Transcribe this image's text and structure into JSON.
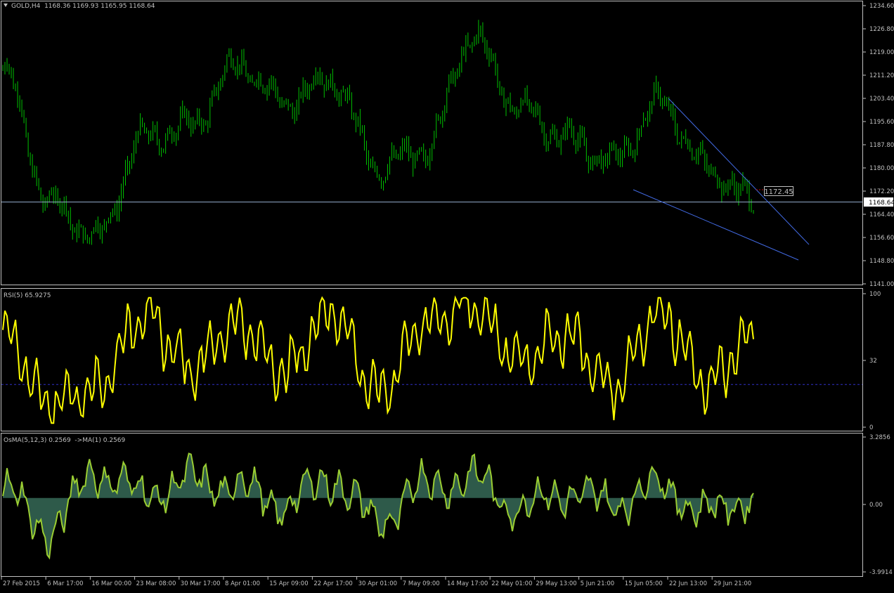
{
  "colors": {
    "background": "#000000",
    "frame": "#C0C0C0",
    "candles": "#00C000",
    "rsi_line": "#FFFF00",
    "osma_line": "#9ACD32",
    "osma_fill": "#2E5A4A",
    "trendline": "#4169E1",
    "bid_line": "#8FA8C8",
    "level_line": "#3030C8",
    "alert_line": "#C00000",
    "text": "#C0C0C0"
  },
  "price_panel": {
    "title": "GOLD,H4  1168.36 1169.93 1165.95 1168.64",
    "symbol_icon": "triangle-down-icon",
    "current_price_label": "1168.64",
    "marker_label": "1172.45",
    "marker_price": 1172.45,
    "y_axis_labels": [
      "1234.60",
      "1226.80",
      "1219.00",
      "1211.20",
      "1203.40",
      "1195.60",
      "1187.80",
      "1180.00",
      "1172.20",
      "1164.40",
      "1156.60",
      "1148.80",
      "1141.00"
    ]
  },
  "rsi_panel": {
    "title": "RSI(5) 65.9275",
    "y_axis_labels": [
      "100",
      "32",
      "0"
    ],
    "level": 32
  },
  "osma_panel": {
    "title": "OsMA(5,12,3) 0.2569  ->MA(1) 0.2569",
    "y_axis_labels": [
      "3.2856",
      "0.00",
      "-3.9914"
    ]
  },
  "time_axis": {
    "labels": [
      "27 Feb 2015",
      "6 Mar 17:00",
      "16 Mar 00:00",
      "23 Mar 08:00",
      "30 Mar 17:00",
      "8 Apr 01:00",
      "15 Apr 09:00",
      "22 Apr 17:00",
      "30 Apr 01:00",
      "7 May 09:00",
      "14 May 17:00",
      "22 May 01:00",
      "29 May 13:00",
      "5 Jun 21:00",
      "15 Jun 05:00",
      "22 Jun 13:00",
      "29 Jun 21:00"
    ]
  },
  "chart_data": [
    {
      "type": "line",
      "series": [
        {
          "name": "GOLD,H4",
          "x": [
            "27 Feb 2015",
            "6 Mar 17:00",
            "16 Mar 00:00",
            "23 Mar 08:00",
            "30 Mar 17:00",
            "8 Apr 01:00",
            "15 Apr 09:00",
            "22 Apr 17:00",
            "30 Apr 01:00",
            "7 May 09:00",
            "14 May 17:00",
            "22 May 01:00",
            "29 May 13:00",
            "5 Jun 21:00",
            "15 Jun 05:00",
            "22 Jun 13:00",
            "29 Jun 21:00"
          ],
          "values": [
            1213,
            1168,
            1157,
            1190,
            1194,
            1215,
            1202,
            1210,
            1180,
            1186,
            1224,
            1200,
            1190,
            1182,
            1202,
            1180,
            1168.64
          ]
        }
      ],
      "ylim": [
        1141,
        1234.6
      ]
    },
    {
      "type": "line",
      "series": [
        {
          "name": "RSI(5)",
          "x": [
            "27 Feb 2015",
            "6 Mar 17:00",
            "16 Mar 00:00",
            "23 Mar 08:00",
            "30 Mar 17:00",
            "8 Apr 01:00",
            "15 Apr 09:00",
            "22 Apr 17:00",
            "30 Apr 01:00",
            "7 May 09:00",
            "14 May 17:00",
            "22 May 01:00",
            "29 May 13:00",
            "5 Jun 21:00",
            "15 Jun 05:00",
            "22 Jun 13:00",
            "29 Jun 21:00"
          ],
          "values": [
            68,
            18,
            30,
            85,
            45,
            78,
            42,
            88,
            25,
            78,
            92,
            50,
            70,
            30,
            88,
            32,
            65.9275
          ]
        }
      ],
      "ylim": [
        0,
        100
      ]
    },
    {
      "type": "area",
      "series": [
        {
          "name": "OsMA(5,12,3)",
          "x": [
            "27 Feb 2015",
            "6 Mar 17:00",
            "16 Mar 00:00",
            "23 Mar 08:00",
            "30 Mar 17:00",
            "8 Apr 01:00",
            "15 Apr 09:00",
            "22 Apr 17:00",
            "30 Apr 01:00",
            "7 May 09:00",
            "14 May 17:00",
            "22 May 01:00",
            "29 May 13:00",
            "5 Jun 21:00",
            "15 Jun 05:00",
            "22 Jun 13:00",
            "29 Jun 21:00"
          ],
          "values": [
            0.8,
            -3.5,
            2.9,
            0.5,
            1.8,
            1.3,
            -0.8,
            2.2,
            -2.6,
            1.4,
            2.1,
            -1.0,
            0.6,
            -0.5,
            1.5,
            -1.6,
            0.2569
          ]
        }
      ],
      "ylim": [
        -3.9914,
        3.2856
      ]
    }
  ]
}
